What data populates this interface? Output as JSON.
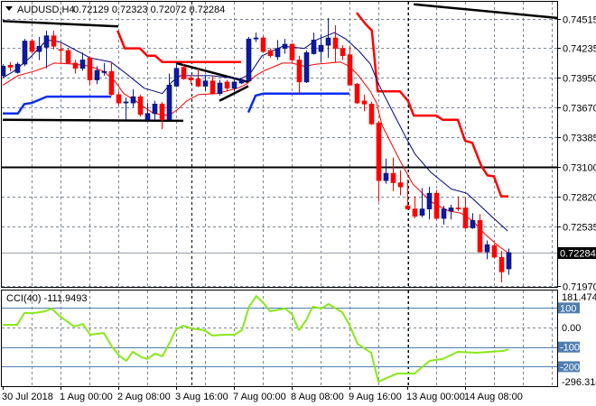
{
  "header": {
    "menu_icon": "triangle-down-icon",
    "symbol": "AUDUSD,H4",
    "ohlc": "0.72129 0.72323 0.72072 0.72284"
  },
  "cci_label": "CCI(40) -111.9493",
  "colors": {
    "bull": "#0c1aa6",
    "bear": "#ff0000",
    "ma": "#000080",
    "ema": "#ff0000",
    "upper_step": "#ff0000",
    "lower_step": "#0a2cf0",
    "trendline": "#000000",
    "grid": "#7a8696",
    "cci": "#88e81a",
    "cci_level": "#4f7eb0",
    "current_price_bg": "#000000"
  },
  "chart_data": {
    "type": "candlestick",
    "title": "AUDUSD,H4",
    "price_ticks": [
      "0.74515",
      "0.74235",
      "0.73950",
      "0.73670",
      "0.73385",
      "0.73100",
      "0.72820",
      "0.72535",
      "0.71970"
    ],
    "current_price": "0.72284",
    "x_labels": [
      {
        "bar": 0,
        "label": "30 Jul 2018"
      },
      {
        "bar": 8,
        "label": "1 Aug 00:00"
      },
      {
        "bar": 16,
        "label": "2 Aug 08:00"
      },
      {
        "bar": 24,
        "label": "3 Aug 16:00"
      },
      {
        "bar": 32,
        "label": "7 Aug 00:00"
      },
      {
        "bar": 40,
        "label": "8 Aug 08:00"
      },
      {
        "bar": 48,
        "label": "9 Aug 16:00"
      },
      {
        "bar": 56,
        "label": "13 Aug 00:00"
      },
      {
        "bar": 64,
        "label": "14 Aug 08:00"
      }
    ],
    "candles_ohlc": [
      [
        0.7397,
        0.7408,
        0.7396,
        0.7406
      ],
      [
        0.7407,
        0.741,
        0.7401,
        0.7405
      ],
      [
        0.74,
        0.741,
        0.7399,
        0.7408
      ],
      [
        0.7408,
        0.7432,
        0.7406,
        0.743
      ],
      [
        0.743,
        0.7432,
        0.7418,
        0.742
      ],
      [
        0.742,
        0.7434,
        0.7412,
        0.7425
      ],
      [
        0.7424,
        0.744,
        0.7404,
        0.7435
      ],
      [
        0.7435,
        0.744,
        0.7422,
        0.7425
      ],
      [
        0.7422,
        0.7428,
        0.7408,
        0.7421
      ],
      [
        0.7421,
        0.7423,
        0.7408,
        0.7409
      ],
      [
        0.7409,
        0.7412,
        0.7399,
        0.7404
      ],
      [
        0.7404,
        0.7419,
        0.7402,
        0.7412
      ],
      [
        0.7414,
        0.7415,
        0.7388,
        0.7393
      ],
      [
        0.7393,
        0.7406,
        0.7389,
        0.7402
      ],
      [
        0.74,
        0.7409,
        0.7397,
        0.7401
      ],
      [
        0.7401,
        0.741,
        0.7378,
        0.7379
      ],
      [
        0.7379,
        0.7382,
        0.7369,
        0.7371
      ],
      [
        0.7371,
        0.7376,
        0.7355,
        0.7372
      ],
      [
        0.7371,
        0.7384,
        0.7367,
        0.7377
      ],
      [
        0.7377,
        0.7379,
        0.7358,
        0.736
      ],
      [
        0.7355,
        0.7371,
        0.7354,
        0.7361
      ],
      [
        0.7361,
        0.7373,
        0.7355,
        0.737
      ],
      [
        0.737,
        0.7372,
        0.7346,
        0.7355
      ],
      [
        0.7355,
        0.7399,
        0.7355,
        0.7388
      ],
      [
        0.7387,
        0.741,
        0.7386,
        0.7404
      ],
      [
        0.7405,
        0.7408,
        0.7393,
        0.7394
      ],
      [
        0.7395,
        0.7397,
        0.7389,
        0.7393
      ],
      [
        0.7394,
        0.7404,
        0.7386,
        0.7387
      ],
      [
        0.7387,
        0.7397,
        0.7382,
        0.7392
      ],
      [
        0.7392,
        0.7397,
        0.7379,
        0.738
      ],
      [
        0.738,
        0.7393,
        0.7378,
        0.739
      ],
      [
        0.7391,
        0.7393,
        0.7382,
        0.7385
      ],
      [
        0.7385,
        0.7393,
        0.7382,
        0.7391
      ],
      [
        0.739,
        0.7395,
        0.7389,
        0.7393
      ],
      [
        0.7392,
        0.7434,
        0.7391,
        0.7432
      ],
      [
        0.7432,
        0.7438,
        0.7429,
        0.7433
      ],
      [
        0.7433,
        0.7435,
        0.7419,
        0.742
      ],
      [
        0.7421,
        0.7423,
        0.7414,
        0.7416
      ],
      [
        0.7415,
        0.7431,
        0.7412,
        0.7423
      ],
      [
        0.7423,
        0.7432,
        0.7418,
        0.7427
      ],
      [
        0.7427,
        0.7428,
        0.741,
        0.7412
      ],
      [
        0.7412,
        0.7416,
        0.738,
        0.7391
      ],
      [
        0.7391,
        0.7421,
        0.739,
        0.7419
      ],
      [
        0.7418,
        0.7438,
        0.7417,
        0.7431
      ],
      [
        0.742,
        0.7436,
        0.741,
        0.7426
      ],
      [
        0.7426,
        0.7452,
        0.7414,
        0.7433
      ],
      [
        0.7433,
        0.7445,
        0.741,
        0.7423
      ],
      [
        0.7423,
        0.7426,
        0.7412,
        0.7416
      ],
      [
        0.7417,
        0.7425,
        0.7388,
        0.7388
      ],
      [
        0.7389,
        0.739,
        0.737,
        0.7371
      ],
      [
        0.7373,
        0.7379,
        0.7363,
        0.737
      ],
      [
        0.737,
        0.7372,
        0.735,
        0.7351
      ],
      [
        0.7352,
        0.7354,
        0.7277,
        0.7297
      ],
      [
        0.7297,
        0.7318,
        0.7294,
        0.7304
      ],
      [
        0.7304,
        0.7319,
        0.7287,
        0.7295
      ],
      [
        0.7295,
        0.7307,
        0.7283,
        0.7291
      ],
      [
        0.7273,
        0.7298,
        0.727,
        0.727
      ],
      [
        0.727,
        0.7282,
        0.7261,
        0.7263
      ],
      [
        0.7264,
        0.729,
        0.7262,
        0.727
      ],
      [
        0.727,
        0.7291,
        0.726,
        0.7285
      ],
      [
        0.7285,
        0.7288,
        0.726,
        0.7261
      ],
      [
        0.7261,
        0.7273,
        0.7255,
        0.727
      ],
      [
        0.7268,
        0.7274,
        0.726,
        0.7271
      ],
      [
        0.7271,
        0.7282,
        0.7268,
        0.727
      ],
      [
        0.7271,
        0.7281,
        0.7251,
        0.7252
      ],
      [
        0.7252,
        0.7266,
        0.7251,
        0.7259
      ],
      [
        0.7259,
        0.7265,
        0.7229,
        0.7229
      ],
      [
        0.7229,
        0.724,
        0.7222,
        0.7236
      ],
      [
        0.7235,
        0.7237,
        0.7223,
        0.7224
      ],
      [
        0.7224,
        0.723,
        0.72,
        0.721
      ],
      [
        0.72129,
        0.72323,
        0.72072,
        0.72284
      ]
    ],
    "overlays": {
      "ma_bar_price": [
        [
          0,
          0.7395
        ],
        [
          1.5,
          0.7401
        ],
        [
          3.75,
          0.7414
        ],
        [
          6.1,
          0.7431
        ],
        [
          8,
          0.7429
        ],
        [
          12.1,
          0.7414
        ],
        [
          15,
          0.741
        ],
        [
          17.1,
          0.7399
        ],
        [
          19.6,
          0.7385
        ],
        [
          22.1,
          0.738
        ],
        [
          23.4,
          0.7391
        ],
        [
          24.6,
          0.7397
        ],
        [
          28.75,
          0.7397
        ],
        [
          33,
          0.7394
        ],
        [
          34.25,
          0.7399
        ],
        [
          35.9,
          0.7416
        ],
        [
          38.75,
          0.7425
        ],
        [
          41.75,
          0.7423
        ],
        [
          43.4,
          0.7431
        ],
        [
          45.9,
          0.7438
        ],
        [
          47.5,
          0.7432
        ],
        [
          49.25,
          0.7421
        ],
        [
          50.9,
          0.7408
        ],
        [
          52.1,
          0.7388
        ],
        [
          54.25,
          0.7359
        ],
        [
          55.9,
          0.7337
        ],
        [
          57.1,
          0.7322
        ],
        [
          59.25,
          0.7305
        ],
        [
          62.1,
          0.7289
        ],
        [
          64.25,
          0.7285
        ],
        [
          65.5,
          0.7277
        ],
        [
          67.5,
          0.7264
        ],
        [
          69.9,
          0.7249
        ]
      ],
      "ema_bar_price": [
        [
          0,
          0.7388
        ],
        [
          2.1,
          0.7397
        ],
        [
          4.25,
          0.7401
        ],
        [
          5.9,
          0.7405
        ],
        [
          7.1,
          0.7409
        ],
        [
          10,
          0.7408
        ],
        [
          12.1,
          0.7406
        ],
        [
          14,
          0.7401
        ],
        [
          15.5,
          0.7392
        ],
        [
          16.75,
          0.738
        ],
        [
          18.4,
          0.7373
        ],
        [
          19.6,
          0.7367
        ],
        [
          20.9,
          0.7361
        ],
        [
          23,
          0.7359
        ],
        [
          24.25,
          0.7365
        ],
        [
          25.5,
          0.7373
        ],
        [
          27.1,
          0.7379
        ],
        [
          29.6,
          0.738
        ],
        [
          32.5,
          0.7385
        ],
        [
          33.75,
          0.7389
        ],
        [
          35,
          0.7397
        ],
        [
          36.25,
          0.7402
        ],
        [
          38.75,
          0.7409
        ],
        [
          40,
          0.7409
        ],
        [
          41.75,
          0.7406
        ],
        [
          43.4,
          0.7408
        ],
        [
          46.75,
          0.741
        ],
        [
          48,
          0.7406
        ],
        [
          49.25,
          0.7397
        ],
        [
          50.9,
          0.7382
        ],
        [
          51.75,
          0.7371
        ],
        [
          52.5,
          0.735
        ],
        [
          55,
          0.7316
        ],
        [
          56.75,
          0.7294
        ],
        [
          59.25,
          0.7277
        ],
        [
          61.75,
          0.7268
        ],
        [
          63.4,
          0.7266
        ],
        [
          65,
          0.7259
        ],
        [
          66.75,
          0.7246
        ],
        [
          68.75,
          0.7234
        ],
        [
          70,
          0.7228
        ]
      ],
      "upper_step_segments": [
        [
          [
            15.9,
            0.744
          ],
          [
            16.9,
            0.7423
          ],
          [
            19,
            0.7423
          ],
          [
            20,
            0.7416
          ],
          [
            21.1,
            0.7416
          ],
          [
            22.1,
            0.741
          ],
          [
            33,
            0.741
          ]
        ],
        [
          [
            49,
            0.7457
          ],
          [
            50.25,
            0.7446
          ],
          [
            51.1,
            0.744
          ],
          [
            51.9,
            0.7382
          ],
          [
            55,
            0.7382
          ],
          [
            56.1,
            0.7373
          ],
          [
            56.9,
            0.7359
          ],
          [
            60,
            0.7359
          ],
          [
            60.9,
            0.7355
          ],
          [
            63,
            0.7355
          ],
          [
            64,
            0.7335
          ],
          [
            65,
            0.7333
          ],
          [
            66.25,
            0.7311
          ],
          [
            67.1,
            0.7302
          ],
          [
            68,
            0.7301
          ],
          [
            69,
            0.7282
          ],
          [
            70,
            0.7282
          ]
        ]
      ],
      "lower_step_segments": [
        [
          [
            0,
            0.7361
          ],
          [
            2.1,
            0.7361
          ],
          [
            3,
            0.737
          ],
          [
            4,
            0.7371
          ],
          [
            6.1,
            0.7377
          ],
          [
            15,
            0.7377
          ]
        ],
        [
          [
            34,
            0.7362
          ],
          [
            35,
            0.7378
          ],
          [
            36.1,
            0.738
          ],
          [
            48,
            0.738
          ]
        ]
      ],
      "trendlines": [
        [
          [
            0,
            0.7449
          ],
          [
            16,
            0.7444
          ]
        ],
        [
          [
            56.9,
            0.7465
          ],
          [
            76.75,
            0.7452
          ]
        ],
        [
          [
            0,
            0.7355
          ],
          [
            25,
            0.7354
          ]
        ],
        [
          [
            24,
            0.7409
          ],
          [
            34,
            0.7391
          ]
        ],
        [
          [
            30,
            0.7373
          ],
          [
            34,
            0.7387
          ]
        ]
      ],
      "horizontal_level": 0.731,
      "period_separator_bars": [
        26.1,
        56.1
      ]
    },
    "cci": {
      "period": 40,
      "value": -111.9493,
      "range": [
        -296.314,
        181.4744
      ],
      "ticks": [
        {
          "label": "181.4744",
          "value": 181.4744,
          "boxed": false
        },
        {
          "label": "100",
          "value": 100,
          "boxed": true
        },
        {
          "label": "0.00",
          "value": 0,
          "boxed": false
        },
        {
          "label": "-100",
          "value": -100,
          "boxed": true
        },
        {
          "label": "-200",
          "value": -200,
          "boxed": true
        },
        {
          "label": "-296.314",
          "value": -296.314,
          "boxed": false
        }
      ],
      "levels": [
        100,
        -100,
        -200
      ],
      "bar_value": [
        [
          0,
          14
        ],
        [
          2,
          14
        ],
        [
          3,
          74
        ],
        [
          4.4,
          74
        ],
        [
          5.9,
          83
        ],
        [
          6.75,
          97
        ],
        [
          8,
          55
        ],
        [
          9.9,
          5
        ],
        [
          11.1,
          18
        ],
        [
          12.1,
          -37
        ],
        [
          14,
          -28
        ],
        [
          15.1,
          -97
        ],
        [
          16.1,
          -143
        ],
        [
          17.1,
          -170
        ],
        [
          18,
          -124
        ],
        [
          19.25,
          -152
        ],
        [
          20,
          -161
        ],
        [
          21.1,
          -133
        ],
        [
          22.1,
          -147
        ],
        [
          23.1,
          -78
        ],
        [
          24,
          -9
        ],
        [
          25,
          9
        ],
        [
          26.1,
          -5
        ],
        [
          27.9,
          -14
        ],
        [
          29,
          -41
        ],
        [
          30.75,
          -37
        ],
        [
          32.1,
          -37
        ],
        [
          33.1,
          -14
        ],
        [
          34.1,
          106
        ],
        [
          35.1,
          161
        ],
        [
          36,
          129
        ],
        [
          37,
          83
        ],
        [
          39.1,
          97
        ],
        [
          40,
          69
        ],
        [
          41,
          -14
        ],
        [
          42,
          37
        ],
        [
          42.9,
          106
        ],
        [
          44.1,
          97
        ],
        [
          45.1,
          120
        ],
        [
          47,
          78
        ],
        [
          48,
          14
        ],
        [
          49.1,
          -83
        ],
        [
          51,
          -129
        ],
        [
          52,
          -276
        ],
        [
          54.6,
          -235
        ],
        [
          57,
          -235
        ],
        [
          59.1,
          -170
        ],
        [
          60.9,
          -161
        ],
        [
          63,
          -124
        ],
        [
          65.6,
          -129
        ],
        [
          67.5,
          -124
        ],
        [
          69.25,
          -120
        ],
        [
          70,
          -112
        ]
      ]
    }
  }
}
